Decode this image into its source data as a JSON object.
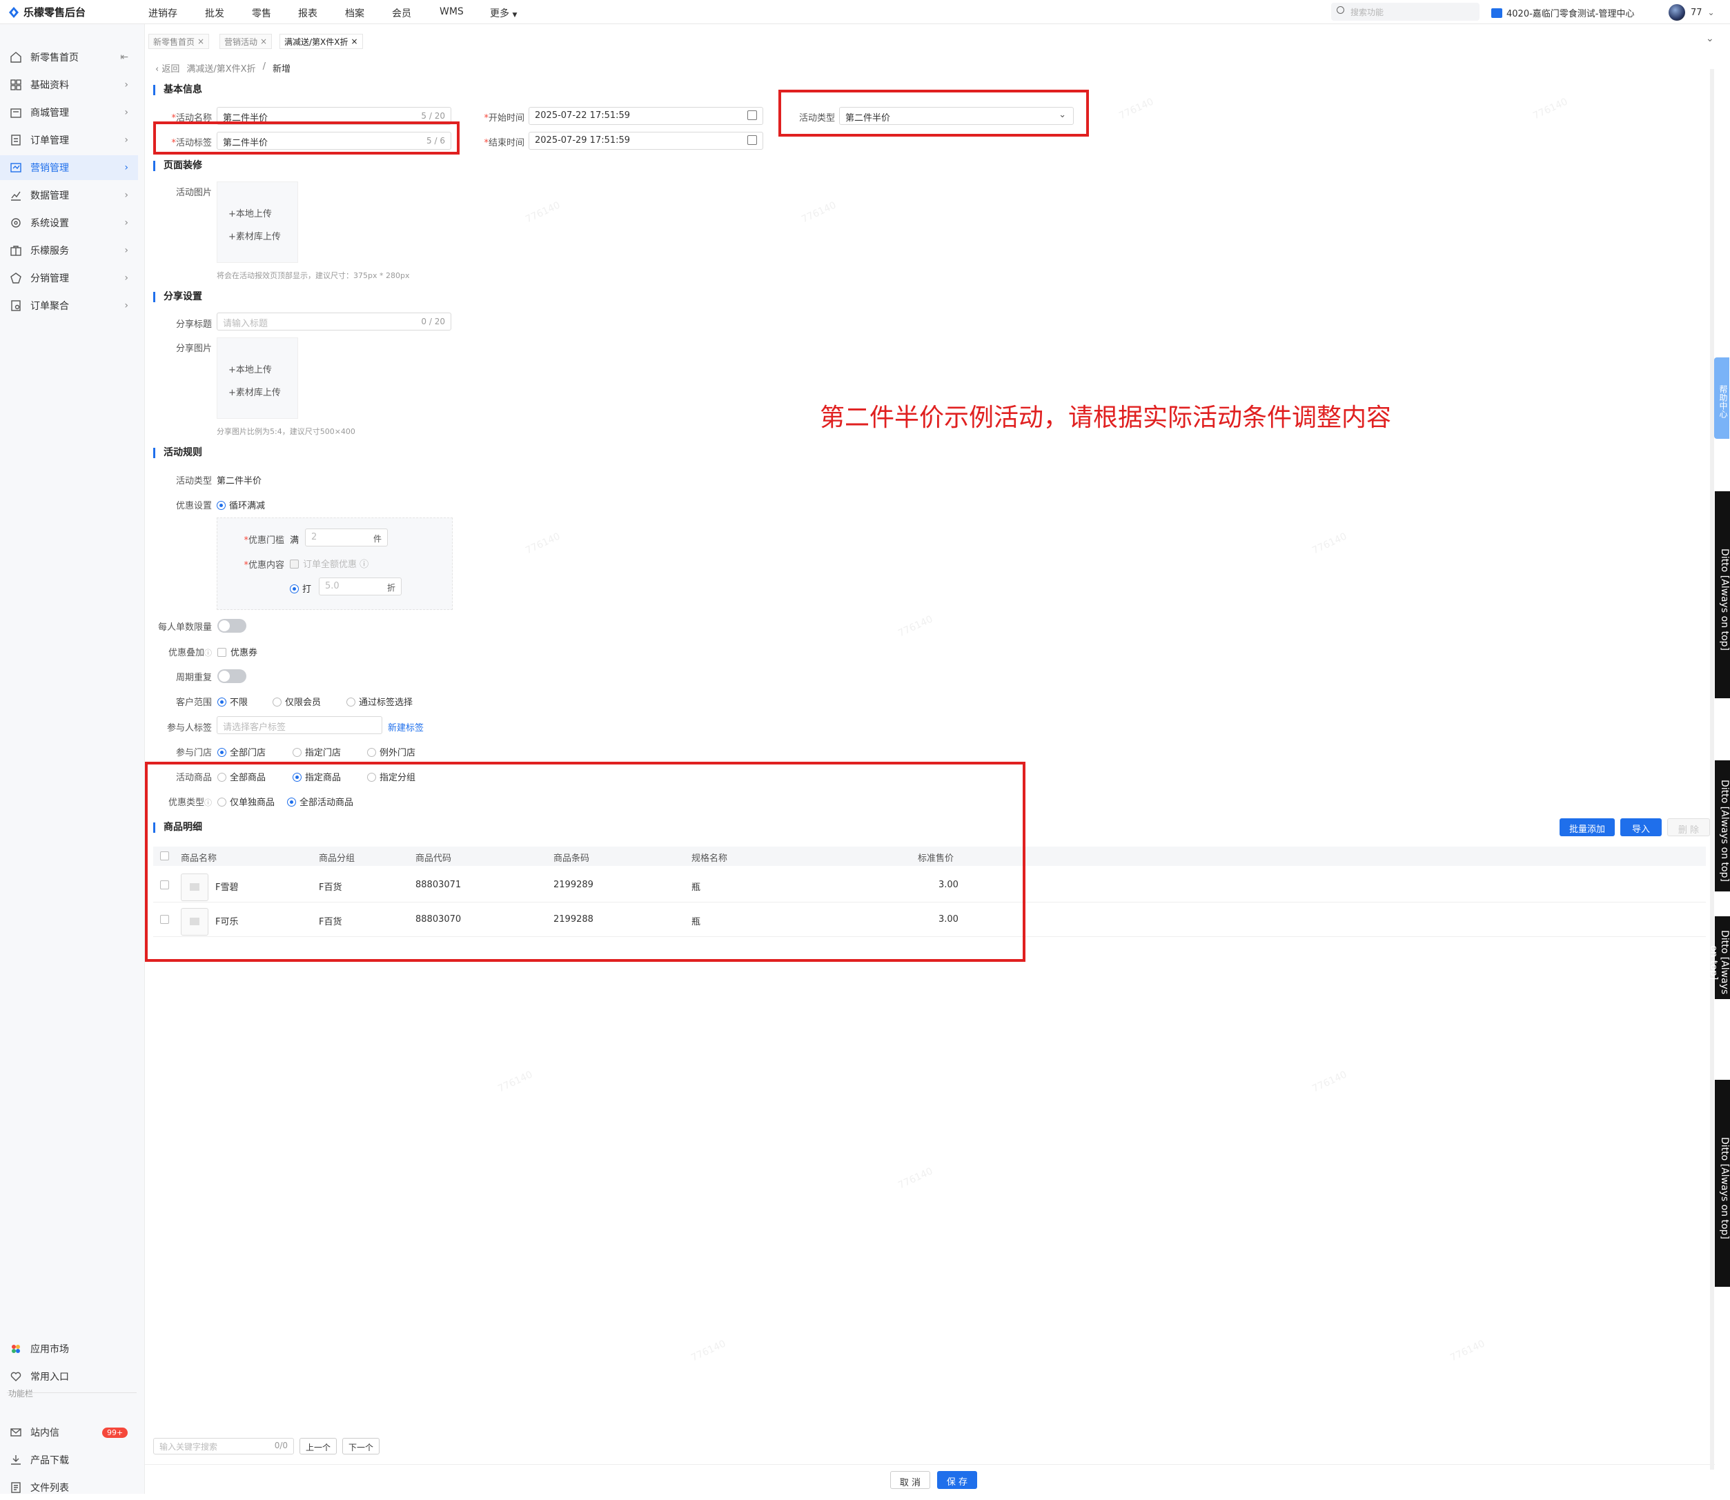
{
  "app": {
    "logo_text": "乐檬零售后台"
  },
  "topnav": [
    "进销存",
    "批发",
    "零售",
    "报表",
    "档案",
    "会员",
    "WMS",
    "更多"
  ],
  "search_placeholder": "搜索功能",
  "store_name": "4020-嘉临门零食测试-管理中心",
  "user_name": "77",
  "sidebar": {
    "items": [
      {
        "label": "新零售首页",
        "icon": "home-icon"
      },
      {
        "label": "基础资料",
        "icon": "grid-icon"
      },
      {
        "label": "商城管理",
        "icon": "shop-icon"
      },
      {
        "label": "订单管理",
        "icon": "order-icon"
      },
      {
        "label": "营销管理",
        "icon": "marketing-icon"
      },
      {
        "label": "数据管理",
        "icon": "chart-icon"
      },
      {
        "label": "系统设置",
        "icon": "settings-icon"
      },
      {
        "label": "乐檬服务",
        "icon": "service-icon"
      },
      {
        "label": "分销管理",
        "icon": "distribution-icon"
      },
      {
        "label": "订单聚合",
        "icon": "aggregate-icon"
      }
    ],
    "bottom_items": [
      {
        "label": "应用市场",
        "icon": "app-market-icon"
      },
      {
        "label": "常用入口",
        "icon": "heart-icon"
      }
    ],
    "section_label": "功能栏",
    "func_items": [
      {
        "label": "站内信",
        "icon": "mail-icon"
      },
      {
        "label": "产品下载",
        "icon": "download-icon"
      },
      {
        "label": "文件列表",
        "icon": "file-list-icon"
      }
    ],
    "badge": "99+"
  },
  "tabs": [
    "新零售首页",
    "营销活动",
    "满减送/第X件X折"
  ],
  "breadcrumb": {
    "back": "返回",
    "parent": "满减送/第X件X折",
    "sep": "/",
    "current": "新增"
  },
  "basic": {
    "title": "基本信息",
    "name_label": "活动名称",
    "name_value": "第二件半价",
    "name_count": "5 / 20",
    "tag_label": "活动标签",
    "tag_value": "第二件半价",
    "tag_count": "5 / 6",
    "start_label": "开始时间",
    "start_value": "2025-07-22 17:51:59",
    "end_label": "结束时间",
    "end_value": "2025-07-29 17:51:59",
    "type_label": "活动类型",
    "type_value": "第二件半价"
  },
  "decor": {
    "title": "页面装修",
    "image_label": "活动图片",
    "upload_local": "+本地上传",
    "upload_lib": "+素材库上传",
    "hint": "将会在活动报效页顶部显示，建议尺寸：375px * 280px"
  },
  "share": {
    "title": "分享设置",
    "title_label": "分享标题",
    "title_placeholder": "请输入标题",
    "title_count": "0 / 20",
    "image_label": "分享图片",
    "upload_local": "+本地上传",
    "upload_lib": "+素材库上传",
    "hint": "分享图片比例为5:4，建议尺寸500×400"
  },
  "rules": {
    "title": "活动规则",
    "type_label": "活动类型",
    "type_value": "第二件半价",
    "discount_setting_label": "优惠设置",
    "discount_setting_value": "循环满减",
    "threshold_label": "优惠门槛",
    "threshold_prefix": "满",
    "threshold_value": "2",
    "threshold_unit": "件",
    "content_label": "优惠内容",
    "content_check": "订单全额优惠",
    "discount_radio": "打",
    "discount_value": "5.0",
    "discount_unit": "折",
    "per_order_limit_label": "每人单数限量",
    "stack_label": "优惠叠加",
    "stack_option": "优惠券",
    "cycle_label": "周期重复",
    "customer_label": "客户范围",
    "customer_options": [
      "不限",
      "仅限会员",
      "通过标签选择"
    ],
    "participant_label": "参与人标签",
    "participant_placeholder": "请选择客户标签",
    "new_tag_link": "新建标签",
    "store_label": "参与门店",
    "store_options": [
      "全部门店",
      "指定门店",
      "例外门店"
    ],
    "goods_label": "活动商品",
    "goods_options": [
      "全部商品",
      "指定商品",
      "指定分组"
    ],
    "discount_type_label": "优惠类型",
    "discount_type_options": [
      "仅单独商品",
      "全部活动商品"
    ]
  },
  "goods": {
    "title": "商品明细",
    "buttons": {
      "batch_add": "批量添加",
      "import": "导入",
      "delete": "删 除"
    },
    "columns": [
      "商品名称",
      "商品分组",
      "商品代码",
      "商品条码",
      "规格名称",
      "标准售价"
    ],
    "rows": [
      {
        "name": "F雪碧",
        "group": "F百货",
        "code": "88803071",
        "barcode": "2199289",
        "spec": "瓶",
        "price": "3.00"
      },
      {
        "name": "F可乐",
        "group": "F百货",
        "code": "88803070",
        "barcode": "2199288",
        "spec": "瓶",
        "price": "3.00"
      }
    ]
  },
  "annotation": "第二件半价示例活动，请根据实际活动条件调整内容",
  "find_bar": {
    "placeholder": "输入关键字搜索",
    "count": "0/0",
    "prev": "上一个",
    "next": "下一个"
  },
  "footer": {
    "cancel": "取 消",
    "save": "保 存"
  },
  "help_tab": "帮助中心",
  "ditto_label": "Ditto [Always on top]",
  "watermark": "776140",
  "colors": {
    "primary": "#1f6feb",
    "annotation_red": "#e02020"
  }
}
